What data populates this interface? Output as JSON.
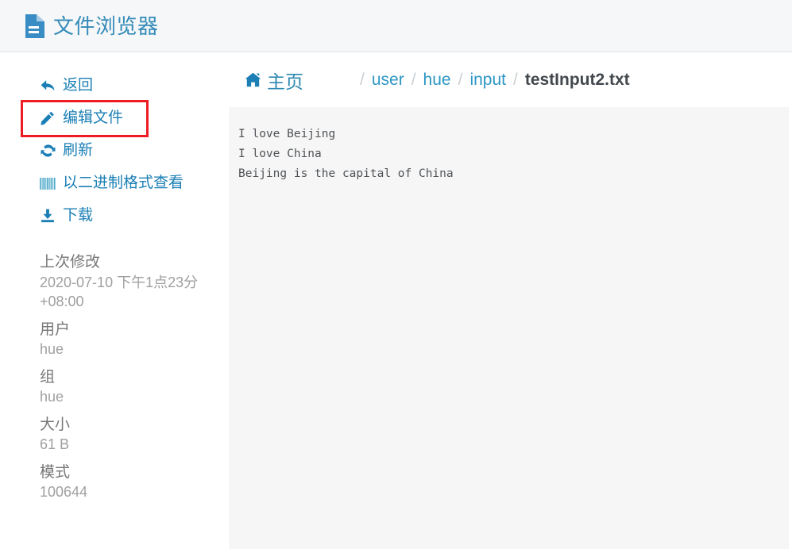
{
  "header": {
    "title": "文件浏览器",
    "icon": "document-icon"
  },
  "sidebar": {
    "actions": [
      {
        "label": "返回",
        "icon": "back-arrow-icon",
        "highlighted": false
      },
      {
        "label": "编辑文件",
        "icon": "pencil-icon",
        "highlighted": true
      },
      {
        "label": "刷新",
        "icon": "refresh-icon",
        "highlighted": false
      },
      {
        "label": "以二进制格式查看",
        "icon": "barcode-icon",
        "highlighted": false
      },
      {
        "label": "下载",
        "icon": "download-icon",
        "highlighted": false
      }
    ],
    "metadata": [
      {
        "label": "上次修改",
        "value": "2020-07-10 下午1点23分 +08:00"
      },
      {
        "label": "用户",
        "value": "hue"
      },
      {
        "label": "组",
        "value": "hue"
      },
      {
        "label": "大小",
        "value": "61 B"
      },
      {
        "label": "模式",
        "value": "100644"
      }
    ]
  },
  "breadcrumb": {
    "home_label": "主页",
    "home_icon": "home-icon",
    "separator": "/",
    "links": [
      "user",
      "hue",
      "input"
    ],
    "current": "testInput2.txt"
  },
  "file_view": {
    "content": "I love Beijing\nI love China\nBeijing is the capital of China"
  },
  "colors": {
    "accent_blue": "#1b7fb5",
    "link_blue": "#2d96c4",
    "highlight_red": "#ee1c25",
    "panel_gray": "#f6f6f6",
    "header_gray": "#f6f7f8"
  }
}
